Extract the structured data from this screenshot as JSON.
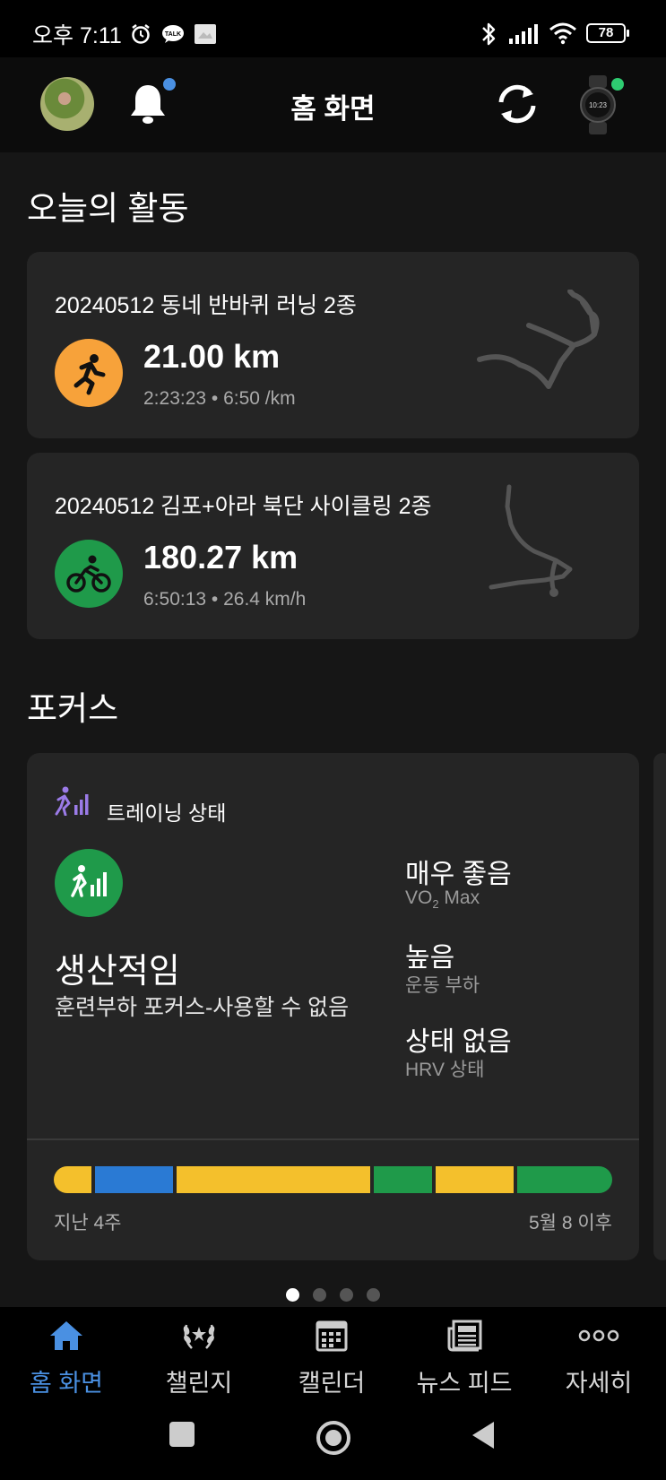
{
  "status_bar": {
    "time": "오후 7:11",
    "battery": "78"
  },
  "header": {
    "title": "홈 화면"
  },
  "today": {
    "section_title": "오늘의 활동",
    "activities": [
      {
        "title": "20240512 동네 반바퀴 러닝 2종",
        "distance": "21.00 km",
        "stats": "2:23:23 • 6:50 /km",
        "color": "#f7a23a",
        "icon": "running-icon"
      },
      {
        "title": "20240512 김포+아라 북단 사이클링 2종",
        "distance": "180.27 km",
        "stats": "6:50:13 • 26.4 km/h",
        "color": "#1f9a4a",
        "icon": "cycling-icon"
      }
    ]
  },
  "focus": {
    "section_title": "포커스",
    "card_label": "트레이닝 상태",
    "status": "생산적임",
    "status_desc": "훈련부하 포커스-사용할 수 없음",
    "metrics": [
      {
        "value": "매우 좋음",
        "label_main": "VO",
        "label_sub": "2",
        "label_rest": " Max"
      },
      {
        "value": "높음",
        "label": "운동 부하"
      },
      {
        "value": "상태 없음",
        "label": "HRV 상태"
      }
    ],
    "bar_segments": [
      {
        "color": "#f4c02c",
        "fraction": 0.065
      },
      {
        "color": "#2a7ad4",
        "fraction": 0.135
      },
      {
        "color": "#f4c02c",
        "fraction": 0.335
      },
      {
        "color": "#1f9a4a",
        "fraction": 0.1
      },
      {
        "color": "#f4c02c",
        "fraction": 0.135
      },
      {
        "color": "#1f9a4a",
        "fraction": 0.165
      }
    ],
    "bar_left": "지난 4주",
    "bar_right": "5월 8 이후"
  },
  "pager": {
    "pages": 4,
    "active": 0
  },
  "nav": {
    "items": [
      {
        "label": "홈 화면",
        "icon": "home-icon",
        "active": true
      },
      {
        "label": "챌린지",
        "icon": "laurel-icon"
      },
      {
        "label": "캘린더",
        "icon": "calendar-icon"
      },
      {
        "label": "뉴스 피드",
        "icon": "newsfeed-icon"
      },
      {
        "label": "자세히",
        "icon": "more-icon"
      }
    ]
  },
  "colors": {
    "accent": "#4a90e2",
    "card": "#252525",
    "background": "#161616"
  }
}
